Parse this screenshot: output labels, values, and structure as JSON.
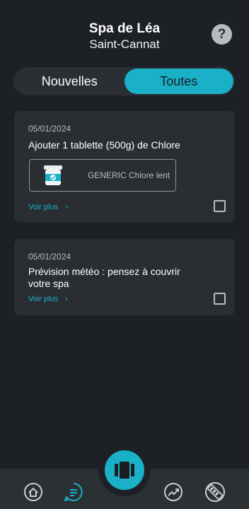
{
  "header": {
    "title": "Spa de Léa",
    "subtitle": "Saint-Cannat",
    "help_label": "?"
  },
  "tabs": [
    {
      "label": "Nouvelles",
      "active": false
    },
    {
      "label": "Toutes",
      "active": true
    }
  ],
  "cards": [
    {
      "date": "05/01/2024",
      "text": "Ajouter 1 tablette (500g) de Chlore",
      "product": {
        "name": "GENERIC Chlore lent",
        "icon": "chlorine-tub-icon"
      },
      "see_more": "Voir plus",
      "checked": false
    },
    {
      "date": "05/01/2024",
      "text": "Prévision météo : pensez à couvrir votre spa",
      "see_more": "Voir plus",
      "checked": false
    }
  ],
  "nav": {
    "items": [
      {
        "icon": "home-icon",
        "active": false
      },
      {
        "icon": "notifications-chat-icon",
        "active": true
      },
      {
        "icon": "spa-icon",
        "active": false
      },
      {
        "icon": "analytics-icon",
        "active": false
      },
      {
        "icon": "test-strip-icon",
        "active": false
      }
    ]
  },
  "colors": {
    "accent": "#1ab0c8",
    "background": "#1d2125",
    "card": "#2a2e33",
    "navbar": "#2b3035"
  }
}
